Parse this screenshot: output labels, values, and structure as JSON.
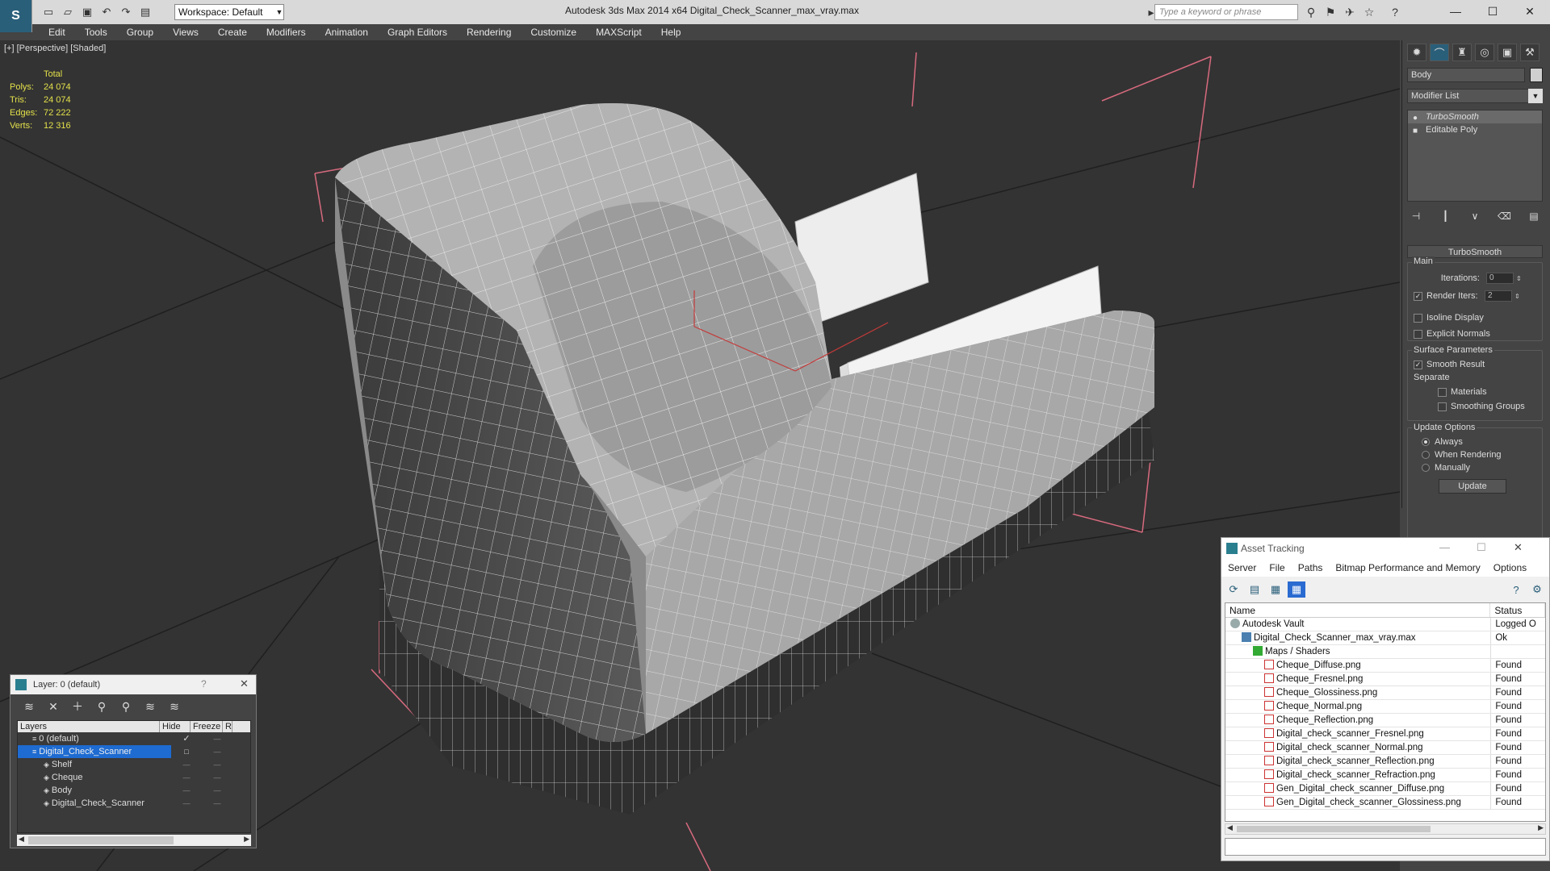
{
  "titlebar": {
    "app_logo": "S",
    "workspace": "Workspace: Default",
    "window_title": "Autodesk 3ds Max  2014 x64      Digital_Check_Scanner_max_vray.max",
    "search_placeholder": "Type a keyword or phrase"
  },
  "menu": [
    "Edit",
    "Tools",
    "Group",
    "Views",
    "Create",
    "Modifiers",
    "Animation",
    "Graph Editors",
    "Rendering",
    "Customize",
    "MAXScript",
    "Help"
  ],
  "viewport": {
    "label": "[+] [Perspective] [Shaded]",
    "stats": {
      "total_label": "Total",
      "rows": [
        {
          "label": "Polys:",
          "value": "24 074"
        },
        {
          "label": "Tris:",
          "value": "24 074"
        },
        {
          "label": "Edges:",
          "value": "72 222"
        },
        {
          "label": "Verts:",
          "value": "12 316"
        }
      ]
    }
  },
  "command_panel": {
    "object_name": "Body",
    "modifier_list": "Modifier List",
    "stack": [
      "TurboSmooth",
      "Editable Poly"
    ],
    "rollout_title": "TurboSmooth",
    "main_label": "Main",
    "iterations_label": "Iterations:",
    "iterations_value": "0",
    "render_iters_label": "Render Iters:",
    "render_iters_value": "2",
    "isoline": "Isoline Display",
    "explicit_normals": "Explicit Normals",
    "surface_params": "Surface Parameters",
    "smooth_result": "Smooth Result",
    "separate": "Separate",
    "materials": "Materials",
    "smoothing_groups": "Smoothing Groups",
    "update_options": "Update Options",
    "always": "Always",
    "when_rendering": "When Rendering",
    "manually": "Manually",
    "update_button": "Update"
  },
  "layer_panel": {
    "title": "Layer: 0 (default)",
    "help": "?",
    "columns": [
      "Layers",
      "Hide",
      "Freeze",
      "R"
    ],
    "rows": [
      {
        "name": "0 (default)",
        "indent": 0
      },
      {
        "name": "Digital_Check_Scanner",
        "indent": 0
      },
      {
        "name": "Shelf",
        "indent": 1
      },
      {
        "name": "Cheque",
        "indent": 1
      },
      {
        "name": "Body",
        "indent": 1
      },
      {
        "name": "Digital_Check_Scanner",
        "indent": 1
      }
    ]
  },
  "asset_panel": {
    "title": "Asset Tracking",
    "menu": [
      "Server",
      "File",
      "Paths",
      "Bitmap Performance and Memory",
      "Options"
    ],
    "columns": [
      "Name",
      "Status"
    ],
    "rows": [
      {
        "name": "Autodesk Vault",
        "status": "Logged O",
        "indent": 0,
        "icon": "vault"
      },
      {
        "name": "Digital_Check_Scanner_max_vray.max",
        "status": "Ok",
        "indent": 1,
        "icon": "max"
      },
      {
        "name": "Maps / Shaders",
        "status": "",
        "indent": 2,
        "icon": "folder"
      },
      {
        "name": "Cheque_Diffuse.png",
        "status": "Found",
        "indent": 3,
        "icon": "png"
      },
      {
        "name": "Cheque_Fresnel.png",
        "status": "Found",
        "indent": 3,
        "icon": "png"
      },
      {
        "name": "Cheque_Glossiness.png",
        "status": "Found",
        "indent": 3,
        "icon": "png"
      },
      {
        "name": "Cheque_Normal.png",
        "status": "Found",
        "indent": 3,
        "icon": "png"
      },
      {
        "name": "Cheque_Reflection.png",
        "status": "Found",
        "indent": 3,
        "icon": "png"
      },
      {
        "name": "Digital_check_scanner_Fresnel.png",
        "status": "Found",
        "indent": 3,
        "icon": "png"
      },
      {
        "name": "Digital_check_scanner_Normal.png",
        "status": "Found",
        "indent": 3,
        "icon": "png"
      },
      {
        "name": "Digital_check_scanner_Reflection.png",
        "status": "Found",
        "indent": 3,
        "icon": "png"
      },
      {
        "name": "Digital_check_scanner_Refraction.png",
        "status": "Found",
        "indent": 3,
        "icon": "png"
      },
      {
        "name": "Gen_Digital_check_scanner_Diffuse.png",
        "status": "Found",
        "indent": 3,
        "icon": "png"
      },
      {
        "name": "Gen_Digital_check_scanner_Glossiness.png",
        "status": "Found",
        "indent": 3,
        "icon": "png"
      }
    ]
  }
}
